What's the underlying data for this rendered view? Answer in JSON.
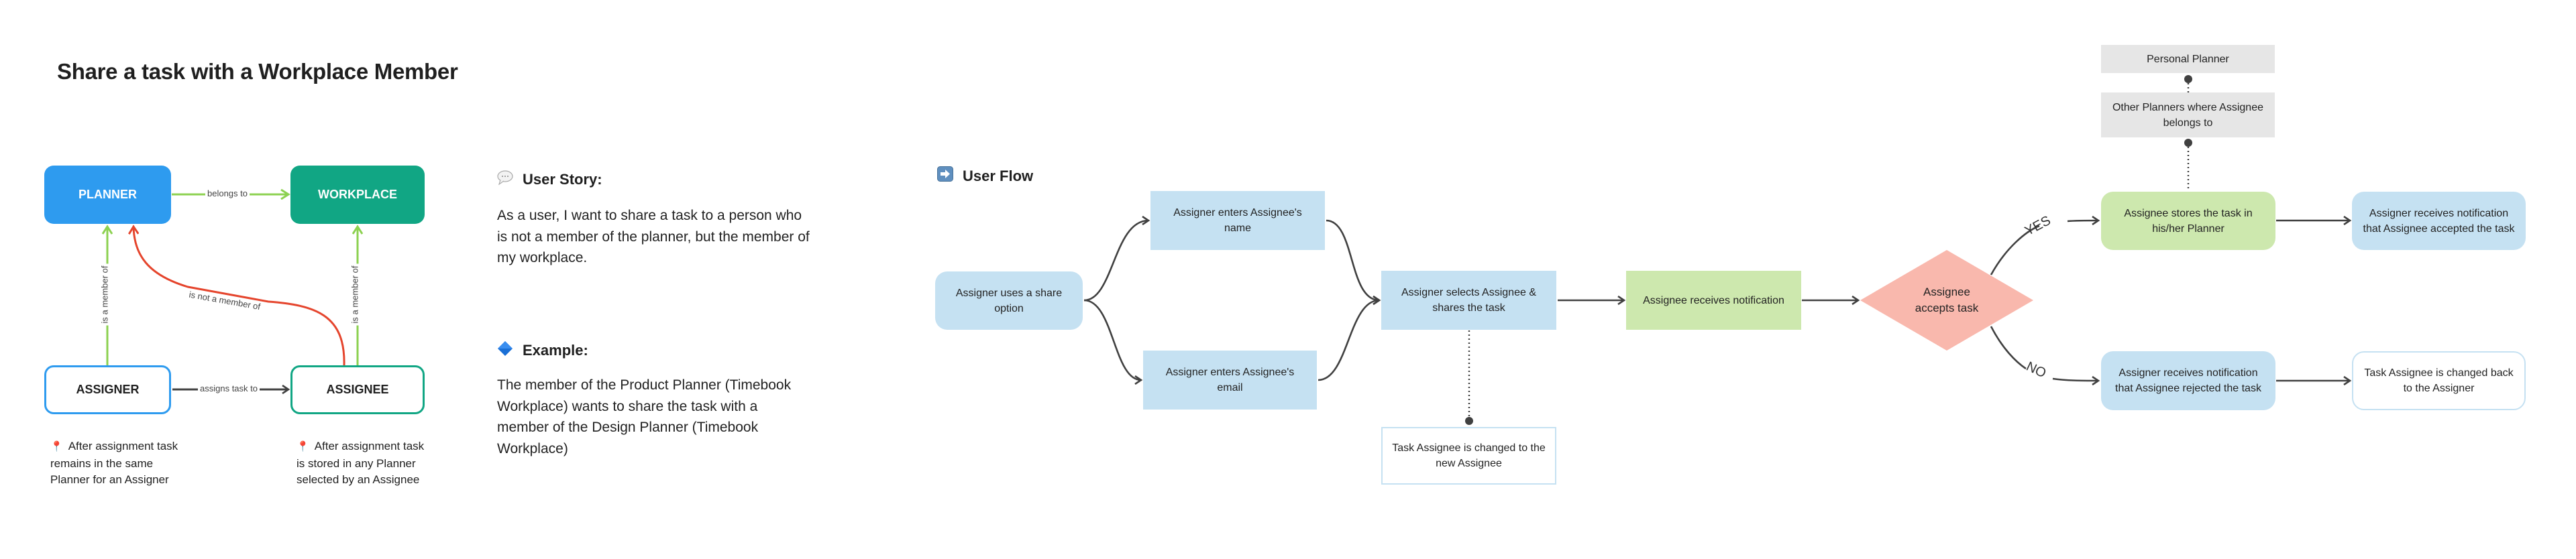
{
  "title": "Share a task with a Workplace Member",
  "colors": {
    "planner": "#2e9bef",
    "workplace": "#11a684",
    "assigner_border": "#2e9bef",
    "assignee_border": "#11a684",
    "green_edge": "#8cd150",
    "red_edge": "#e5452d",
    "dark_edge": "#404040",
    "node_blue": "#c5e1f2",
    "node_green": "#cde8ae",
    "node_gray": "#e6e6e6",
    "decision": "#f9b8ad"
  },
  "entity_diagram": {
    "entities": {
      "planner": "PLANNER",
      "workplace": "WORKPLACE",
      "assigner": "ASSIGNER",
      "assignee": "ASSIGNEE"
    },
    "relations": {
      "belongs_to": "belongs to",
      "assigner_member_of": "is a member of",
      "assignee_member_of": "is a member of",
      "not_member_of": "is not a member of",
      "assigns_task_to": "assigns task to"
    },
    "notes": [
      {
        "icon": "pin-icon",
        "text": "After assignment task remains in the same Planner for an Assigner"
      },
      {
        "icon": "pin-icon",
        "text": "After assignment task is stored in any Planner selected by an Assignee"
      }
    ]
  },
  "story": {
    "user_story_icon": "speech-bubble-icon",
    "user_story_heading": "User Story:",
    "user_story_text": "As a user, I want to share a task to a person who is not a member of the planner, but the member of my workplace.",
    "example_icon": "blue-diamond-icon",
    "example_heading": "Example:",
    "example_text": "The member of the Product Planner (Timebook Workplace) wants to share the task with a member of the Design Planner (Timebook Workplace)"
  },
  "flow": {
    "heading_icon": "right-arrow-icon",
    "heading": "User Flow",
    "nodes": {
      "start": "Assigner uses a share option",
      "enter_name": "Assigner enters Assignee's name",
      "enter_email": "Assigner enters Assignee's email",
      "select_share": "Assigner selects Assignee & shares the task",
      "task_changed": "Task Assignee is changed to the new Assignee",
      "notification": "Assignee receives notification",
      "decision": "Assignee accepts task",
      "stores": "Assignee stores the task in his/her Planner",
      "personal_planner": "Personal Planner",
      "other_planners": "Other Planners where Assignee belongs to",
      "accepted": "Assigner receives notification that Assignee accepted the task",
      "rejected": "Assigner receives notification that Assignee rejected the task",
      "changed_back": "Task Assignee is changed back to the Assigner"
    },
    "branches": {
      "yes": "YES",
      "no": "NO"
    }
  }
}
